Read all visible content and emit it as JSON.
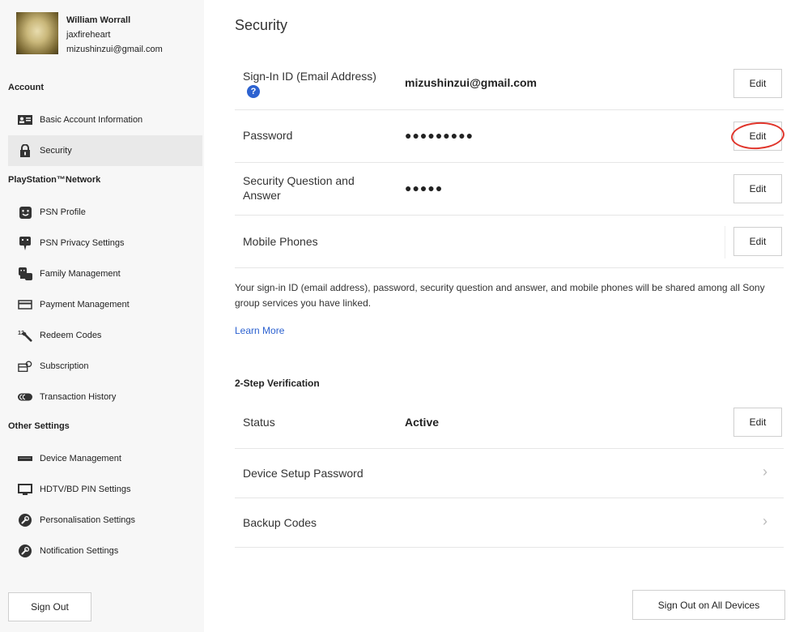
{
  "profile": {
    "name": "William Worrall",
    "online_id": "jaxfireheart",
    "email": "mizushinzui@gmail.com"
  },
  "sidebar": {
    "sections": [
      {
        "title": "Account",
        "items": [
          {
            "label": "Basic Account Information",
            "icon": "id-card-icon"
          },
          {
            "label": "Security",
            "icon": "lock-icon",
            "active": true
          }
        ]
      },
      {
        "title": "PlayStation™Network",
        "items": [
          {
            "label": "PSN Profile",
            "icon": "profile-face-icon"
          },
          {
            "label": "PSN Privacy Settings",
            "icon": "privacy-icon"
          },
          {
            "label": "Family Management",
            "icon": "family-icon"
          },
          {
            "label": "Payment Management",
            "icon": "credit-card-icon"
          },
          {
            "label": "Redeem Codes",
            "icon": "redeem-code-icon"
          },
          {
            "label": "Subscription",
            "icon": "subscription-icon"
          },
          {
            "label": "Transaction History",
            "icon": "transaction-icon"
          }
        ]
      },
      {
        "title": "Other Settings",
        "items": [
          {
            "label": "Device Management",
            "icon": "console-icon"
          },
          {
            "label": "HDTV/BD PIN Settings",
            "icon": "tv-icon"
          },
          {
            "label": "Personalisation Settings",
            "icon": "wrench-icon"
          },
          {
            "label": "Notification Settings",
            "icon": "wrench-icon"
          }
        ]
      }
    ],
    "sign_out_label": "Sign Out"
  },
  "main": {
    "title": "Security",
    "rows": [
      {
        "label": "Sign-In ID (Email Address)",
        "value": "mizushinzui@gmail.com",
        "action": "Edit",
        "help_icon": "?"
      },
      {
        "label": "Password",
        "value": "●●●●●●●●●",
        "action": "Edit"
      },
      {
        "label": "Security Question and Answer",
        "value": "●●●●●",
        "action": "Edit"
      },
      {
        "label": "Mobile Phones",
        "value": "",
        "action": "Edit"
      }
    ],
    "info_text": "Your sign-in ID (email address), password, security question and answer, and mobile phones will be shared among all Sony group services you have linked.",
    "learn_more": "Learn More",
    "two_step": {
      "title": "2-Step Verification",
      "status_label": "Status",
      "status_value": "Active",
      "status_action": "Edit",
      "links": [
        {
          "label": "Device Setup Password",
          "icon": "chevron-right-icon"
        },
        {
          "label": "Backup Codes",
          "icon": "chevron-right-icon"
        }
      ]
    },
    "sign_out_all_label": "Sign Out on All Devices"
  },
  "colors": {
    "link": "#2d62d0",
    "annotation": "#e0352b",
    "sidebar_bg": "#f7f7f7",
    "active_bg": "#e9e9e9"
  }
}
